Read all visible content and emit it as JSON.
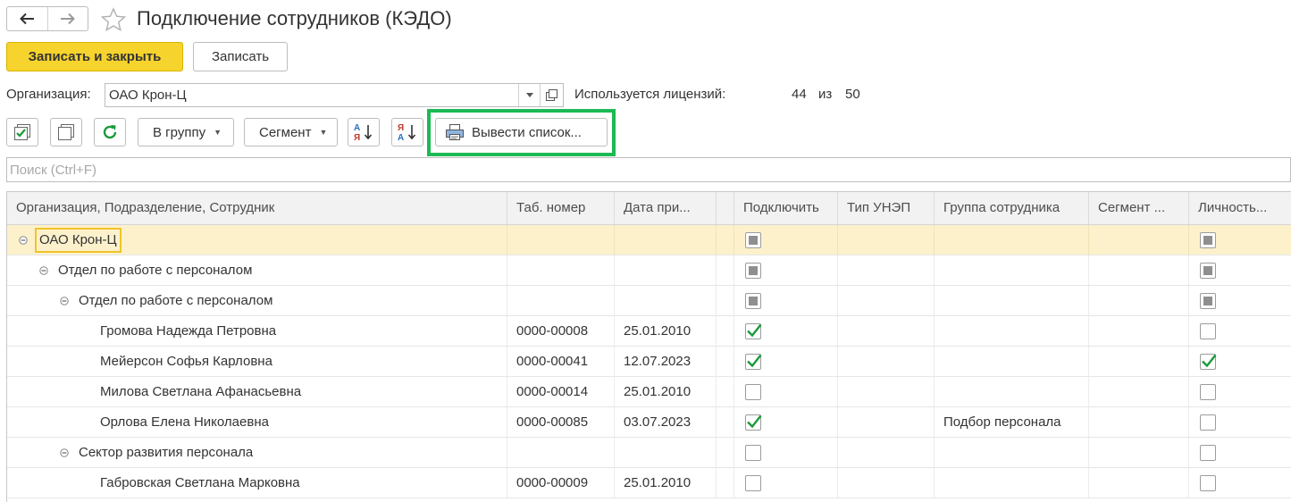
{
  "window": {
    "title": "Подключение сотрудников (КЭДО)"
  },
  "commands": {
    "save_close": "Записать и закрыть",
    "save": "Записать"
  },
  "org": {
    "label": "Организация:",
    "value": "ОАО Крон-Ц"
  },
  "license": {
    "label": "Используется лицензий:",
    "used": "44",
    "of": "из",
    "total": "50"
  },
  "toolbar": {
    "to_group": "В группу",
    "segment": "Сегмент",
    "print_list": "Вывести список..."
  },
  "search": {
    "placeholder": "Поиск (Ctrl+F)"
  },
  "table": {
    "columns": {
      "name": "Организация, Подразделение, Сотрудник",
      "tab": "Таб. номер",
      "date": "Дата при...",
      "connect": "Подключить",
      "type": "Тип УНЭП",
      "group": "Группа сотрудника",
      "segment": "Сегмент ...",
      "personal": "Личность..."
    },
    "rows": [
      {
        "name": "ОАО Крон-Ц",
        "tab": "",
        "date": "",
        "group": "",
        "connect": "partial",
        "personal": "partial"
      },
      {
        "name": "Отдел по работе с персоналом",
        "tab": "",
        "date": "",
        "group": "",
        "connect": "partial",
        "personal": "partial"
      },
      {
        "name": "Отдел по работе с персоналом",
        "tab": "",
        "date": "",
        "group": "",
        "connect": "partial",
        "personal": "partial"
      },
      {
        "name": "Громова Надежда Петровна",
        "tab": "0000-00008",
        "date": "25.01.2010",
        "group": "",
        "connect": "checked",
        "personal": "unchecked"
      },
      {
        "name": "Мейерсон Софья Карловна",
        "tab": "0000-00041",
        "date": "12.07.2023",
        "group": "",
        "connect": "checked",
        "personal": "checked"
      },
      {
        "name": "Милова Светлана Афанасьевна",
        "tab": "0000-00014",
        "date": "25.01.2010",
        "group": "",
        "connect": "unchecked",
        "personal": "unchecked"
      },
      {
        "name": "Орлова Елена Николаевна",
        "tab": "0000-00085",
        "date": "03.07.2023",
        "group": "Подбор персонала",
        "connect": "checked",
        "personal": "unchecked"
      },
      {
        "name": "Сектор развития персонала",
        "tab": "",
        "date": "",
        "group": "",
        "connect": "unchecked",
        "personal": "unchecked"
      },
      {
        "name": "Габровская Светлана Марковна",
        "tab": "0000-00009",
        "date": "25.01.2010",
        "group": "",
        "connect": "unchecked",
        "personal": "unchecked"
      }
    ]
  },
  "colors": {
    "primary": "#f6d32d",
    "highlight": "#1db954",
    "selected_row": "#fdf1cc",
    "check": "#1a9a3a"
  }
}
